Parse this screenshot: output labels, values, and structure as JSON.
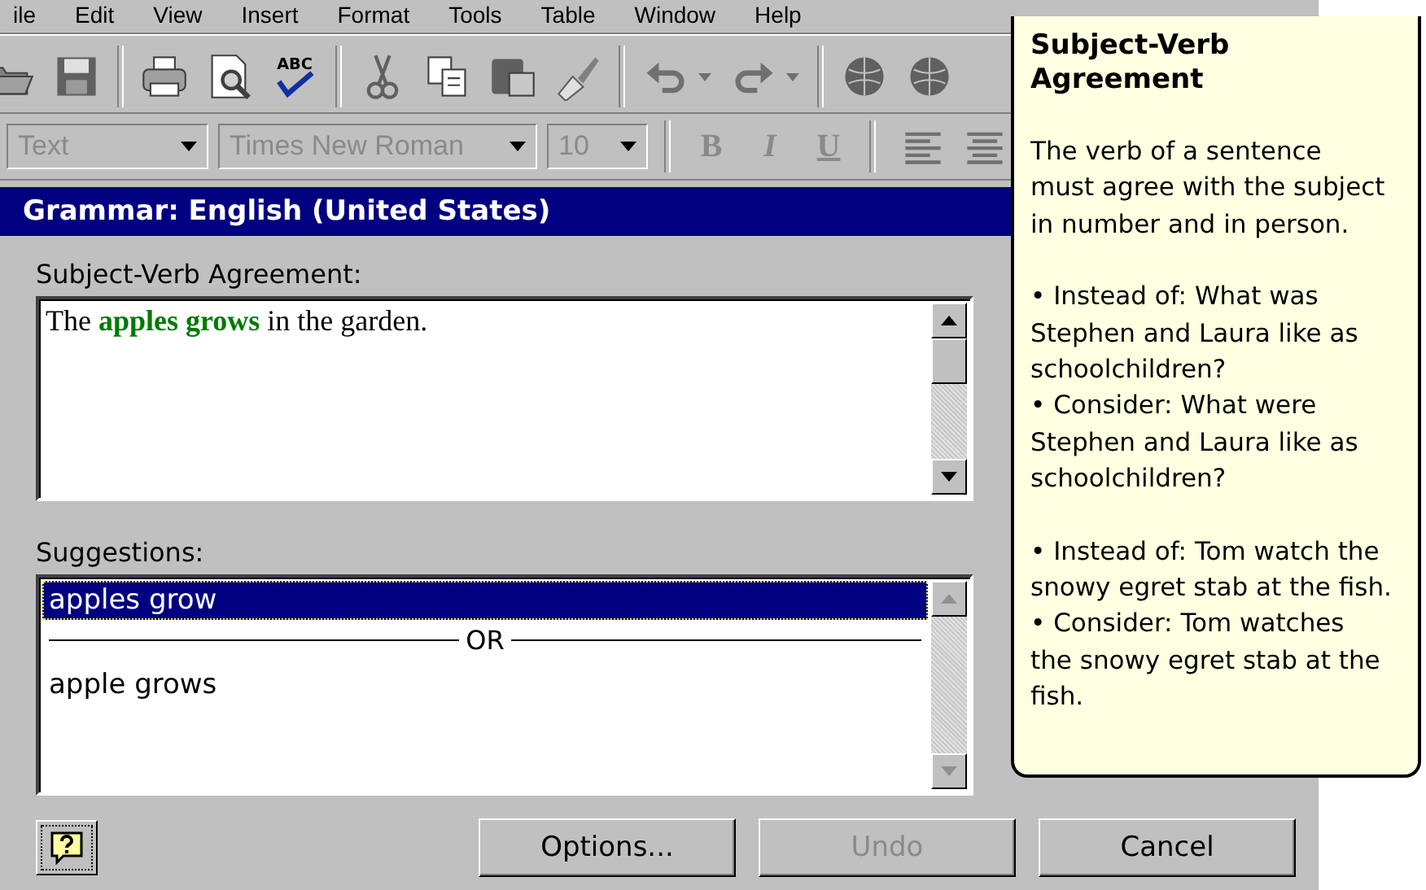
{
  "menu": [
    "ile",
    "Edit",
    "View",
    "Insert",
    "Format",
    "Tools",
    "Table",
    "Window",
    "Help"
  ],
  "toolbar": [
    {
      "kind": "folder"
    },
    {
      "kind": "save"
    },
    {
      "kind": "sep"
    },
    {
      "kind": "print"
    },
    {
      "kind": "preview"
    },
    {
      "kind": "spell",
      "label": "ABC"
    },
    {
      "kind": "sep"
    },
    {
      "kind": "cut"
    },
    {
      "kind": "copy"
    },
    {
      "kind": "paste"
    },
    {
      "kind": "brush"
    },
    {
      "kind": "sep"
    },
    {
      "kind": "undo"
    },
    {
      "kind": "caret"
    },
    {
      "kind": "redo"
    },
    {
      "kind": "caret"
    },
    {
      "kind": "sep"
    },
    {
      "kind": "globe"
    },
    {
      "kind": "globe"
    }
  ],
  "formatting": {
    "disabled": true,
    "style": "Text",
    "font": "Times New Roman",
    "size": "10",
    "buttons": [
      "B",
      "I",
      "U"
    ]
  },
  "dialog": {
    "title": "Grammar: English (United States)",
    "problem_label": "Subject-Verb Agreement:",
    "sentence": "The **apples grows** in the garden.",
    "suggestions_label": "Suggestions:",
    "suggestions": [
      {
        "kind": "item",
        "text": "apples grow",
        "selected": true
      },
      {
        "kind": "separator",
        "text": "OR"
      },
      {
        "kind": "item",
        "text": "apple grows",
        "selected": false
      }
    ],
    "buttons": [
      {
        "label": "Options...",
        "disabled": false
      },
      {
        "label": "Undo",
        "disabled": true
      },
      {
        "label": "Cancel",
        "disabled": false
      }
    ]
  },
  "balloon": {
    "title": "Subject-Verb Agreement",
    "sections": [
      [
        "The verb of a sentence must agree with the subject in number and in person."
      ],
      [
        "• Instead of: What was Stephen and Laura like as schoolchildren?",
        "• Consider: What were Stephen and Laura like as schoolchildren?"
      ],
      [
        "• Instead of: Tom watch the snowy egret stab at the fish.",
        "• Consider: Tom watches the snowy egret stab at the fish."
      ]
    ]
  }
}
